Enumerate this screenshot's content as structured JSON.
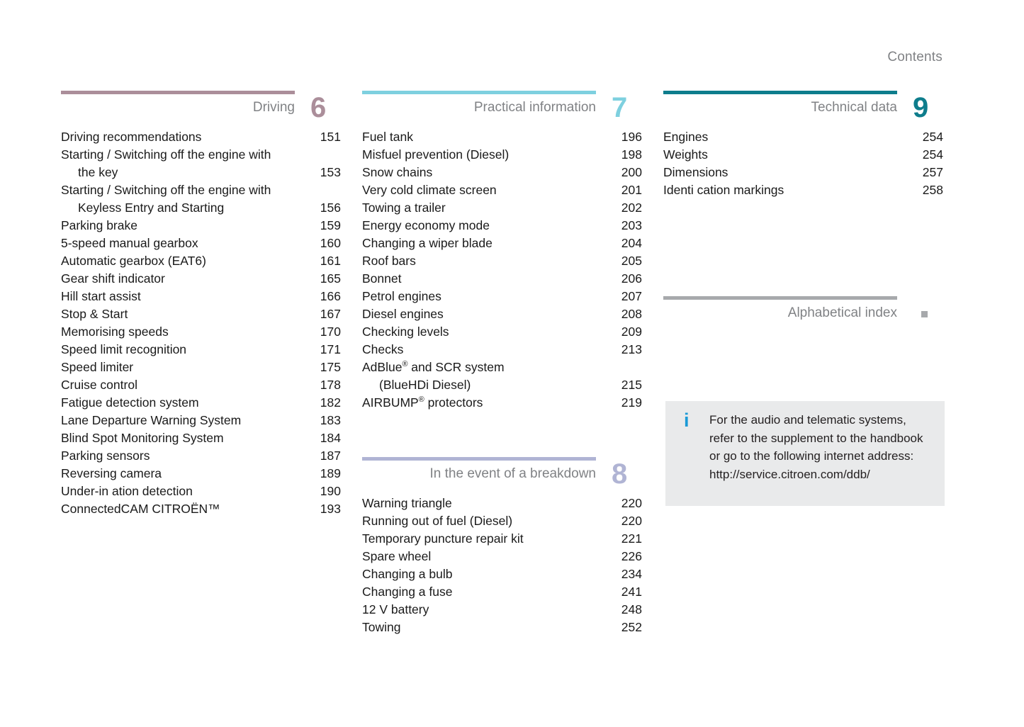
{
  "page": {
    "header": "Contents"
  },
  "colors": {
    "section6": "#ab8e9a",
    "section7": "#7ed0df",
    "section8": "#b0b4d4",
    "section9": "#0e7d8c",
    "index_rule": "#a7a9ac",
    "index_marker": "#a7a9ac",
    "title_gray": "#808285",
    "info_icon_blue": "#1b9ad6",
    "info_bg": "#e9eaeb"
  },
  "sections": [
    {
      "id": "driving",
      "title": "Driving",
      "number": "6",
      "entries": [
        {
          "label": "Driving recommendations",
          "page": "151"
        },
        {
          "label": "Starting / Switching off the engine with",
          "cont": "the key",
          "page": "153"
        },
        {
          "label": "Starting / Switching off the engine with",
          "cont": "Keyless Entry and Starting",
          "page": "156"
        },
        {
          "label": "Parking brake",
          "page": "159"
        },
        {
          "label": "5-speed manual gearbox",
          "page": "160"
        },
        {
          "label": "Automatic gearbox (EAT6)",
          "page": "161"
        },
        {
          "label": "Gear shift indicator",
          "page": "165"
        },
        {
          "label": "Hill start assist",
          "page": "166"
        },
        {
          "label": "Stop & Start",
          "page": "167"
        },
        {
          "label": "Memorising speeds",
          "page": "170"
        },
        {
          "label": "Speed limit recognition",
          "page": "171"
        },
        {
          "label": "Speed limiter",
          "page": "175"
        },
        {
          "label": "Cruise control",
          "page": "178"
        },
        {
          "label": "Fatigue detection system",
          "page": "182"
        },
        {
          "label": "Lane Departure Warning System",
          "page": "183"
        },
        {
          "label": "Blind Spot Monitoring System",
          "page": "184"
        },
        {
          "label": "Parking sensors",
          "page": "187"
        },
        {
          "label": "Reversing camera",
          "page": "189"
        },
        {
          "label": "Under-in ation detection",
          "page": "190"
        },
        {
          "label": "ConnectedCAM CITROËN™",
          "page": "193"
        }
      ]
    },
    {
      "id": "practical-information",
      "title": "Practical information",
      "number": "7",
      "entries": [
        {
          "label": "Fuel tank",
          "page": "196"
        },
        {
          "label": "Misfuel prevention (Diesel)",
          "page": "198"
        },
        {
          "label": "Snow chains",
          "page": "200"
        },
        {
          "label": "Very cold climate screen",
          "page": "201"
        },
        {
          "label": "Towing a trailer",
          "page": "202"
        },
        {
          "label": "Energy economy mode",
          "page": "203"
        },
        {
          "label": "Changing a wiper blade",
          "page": "204"
        },
        {
          "label": "Roof bars",
          "page": "205"
        },
        {
          "label": "Bonnet",
          "page": "206"
        },
        {
          "label": "Petrol engines",
          "page": "207"
        },
        {
          "label": "Diesel engines",
          "page": "208"
        },
        {
          "label": "Checking levels",
          "page": "209"
        },
        {
          "label": "Checks",
          "page": "213"
        },
        {
          "label": "AdBlue® and SCR system",
          "cont": "(BlueHDi Diesel)",
          "page": "215",
          "sup": "first"
        },
        {
          "label": "AIRBUMP® protectors",
          "page": "219",
          "sup": "inline"
        }
      ]
    },
    {
      "id": "in-the-event-of-a-breakdown",
      "title": "In the event of a breakdown",
      "number": "8",
      "entries": [
        {
          "label": "Warning triangle",
          "page": "220"
        },
        {
          "label": "Running out of fuel (Diesel)",
          "page": "220"
        },
        {
          "label": "Temporary puncture repair kit",
          "page": "221"
        },
        {
          "label": "Spare wheel",
          "page": "226"
        },
        {
          "label": "Changing a bulb",
          "page": "234"
        },
        {
          "label": "Changing a fuse",
          "page": "241"
        },
        {
          "label": "12 V battery",
          "page": "248"
        },
        {
          "label": "Towing",
          "page": "252"
        }
      ]
    },
    {
      "id": "technical-data",
      "title": "Technical data",
      "number": "9",
      "entries": [
        {
          "label": "Engines",
          "page": "254"
        },
        {
          "label": "Weights",
          "page": "254"
        },
        {
          "label": "Dimensions",
          "page": "257"
        },
        {
          "label": "Identi cation markings",
          "page": "258"
        }
      ]
    },
    {
      "id": "alphabetical-index",
      "title": "Alphabetical index",
      "number": "",
      "entries": []
    }
  ],
  "info_box": {
    "icon": "info-icon",
    "lines": [
      "For the audio and telematic systems,",
      "refer to the supplement to the handbook",
      "or go to the following internet address:",
      "http://service.citroen.com/ddb/"
    ]
  }
}
